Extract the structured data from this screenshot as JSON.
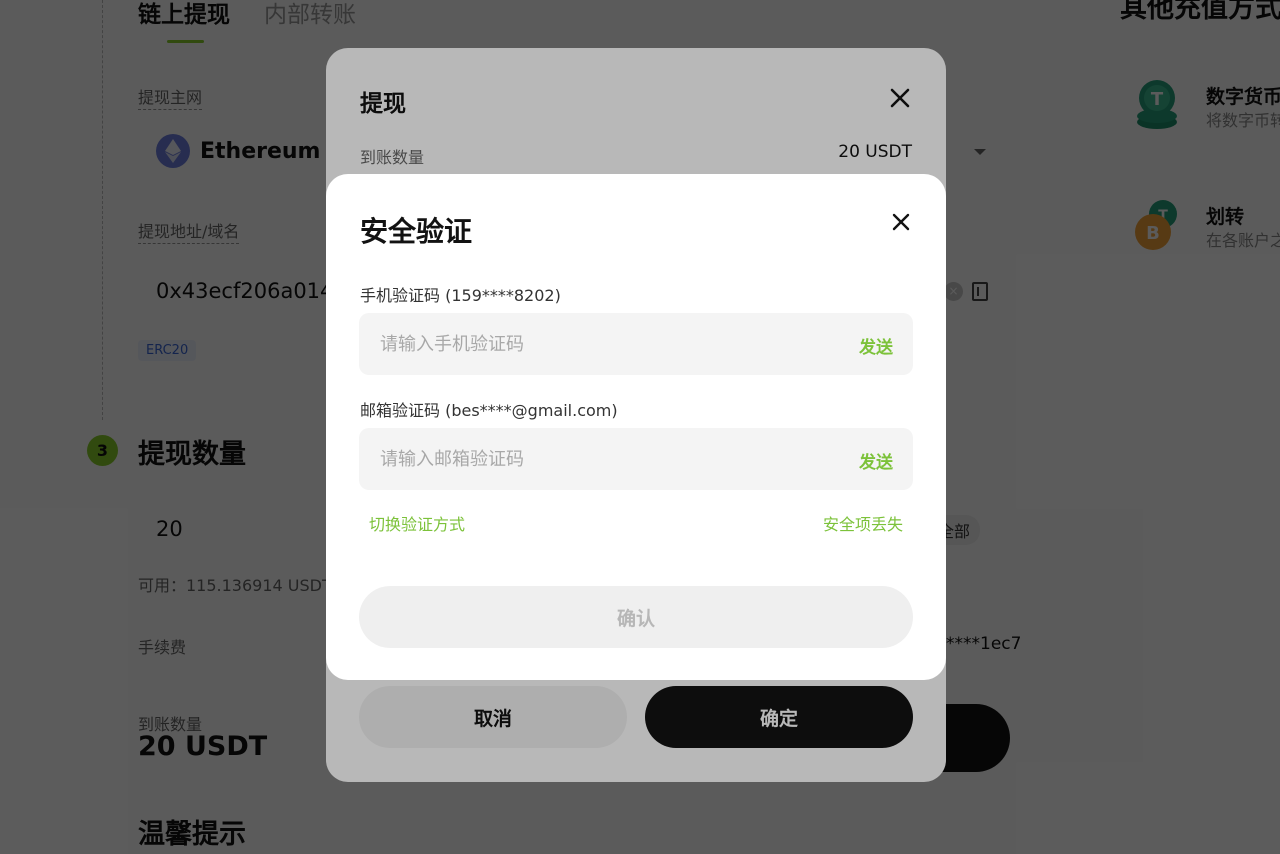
{
  "background": {
    "tabs": [
      {
        "label": "链上提现",
        "active": true
      },
      {
        "label": "内部转账",
        "active": false
      }
    ],
    "network": {
      "label": "提现主网",
      "selected": "Ethereum (E"
    },
    "address": {
      "label": "提现地址/域名",
      "value": "0x43ecf206a014",
      "badge": "ERC20"
    },
    "amount_section": {
      "step": "3",
      "title": "提现数量",
      "amount_value": "20",
      "all_label": "全部",
      "available": "可用：115.136914 USDT",
      "fee_label": "手续费",
      "fee_right": "****1ec7",
      "receive_label": "到账数量",
      "receive_value": "20 USDT"
    },
    "tips_title": "温馨提示",
    "right_panel": {
      "title": "其他充值方式",
      "items": [
        {
          "title": "数字货币",
          "subtitle": "将数字币转"
        },
        {
          "title": "划转",
          "subtitle": "在各账户之"
        }
      ]
    }
  },
  "withdraw_dialog": {
    "title": "提现",
    "receive_label": "到账数量",
    "receive_value": "20 USDT",
    "cancel_label": "取消",
    "ok_label": "确定"
  },
  "security_dialog": {
    "title": "安全验证",
    "phone": {
      "label": "手机验证码 (159****8202)",
      "placeholder": "请输入手机验证码",
      "send": "发送"
    },
    "email": {
      "label": "邮箱验证码 (bes****@gmail.com)",
      "placeholder": "请输入邮箱验证码",
      "send": "发送"
    },
    "switch_method": "切换验证方式",
    "security_lost": "安全项丢失",
    "confirm_label": "确认"
  },
  "colors": {
    "accent": "#7cc23a",
    "step_green": "#8ace2c",
    "primary_button": "#121212",
    "disabled_button": "#efefef"
  },
  "icons": {
    "ethereum": "ethereum-icon",
    "close": "close-icon",
    "address_book": "address-book-icon",
    "clear": "clear-icon",
    "tether": "tether-icon",
    "bitcoin": "bitcoin-icon"
  }
}
